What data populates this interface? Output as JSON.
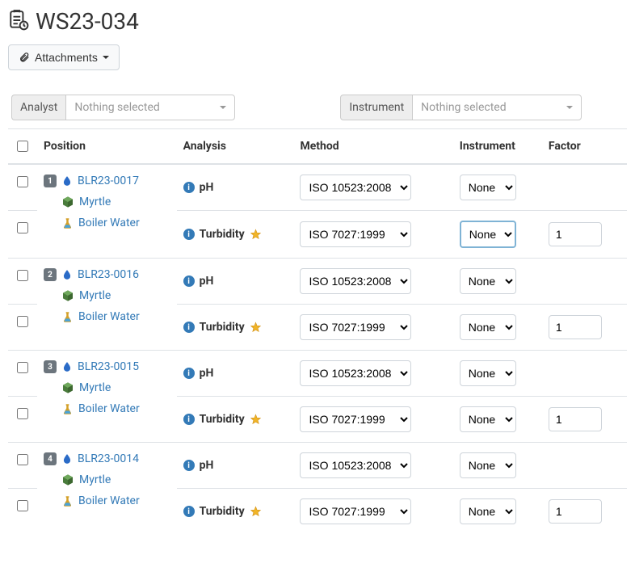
{
  "page": {
    "title": "WS23-034",
    "attachments_button": "Attachments"
  },
  "filters": {
    "analyst_label": "Analyst",
    "analyst_value": "Nothing selected",
    "instrument_label": "Instrument",
    "instrument_value": "Nothing selected"
  },
  "columns": {
    "position": "Position",
    "analysis": "Analysis",
    "method": "Method",
    "instrument": "Instrument",
    "factor": "Factor"
  },
  "instrument_options": {
    "none": "None"
  },
  "method_options": {
    "iso10523": "ISO 10523:2008",
    "iso7027": "ISO 7027:1999"
  },
  "rows": [
    {
      "position": "1",
      "sample_id": "BLR23-0017",
      "client": "Myrtle",
      "sample_type": "Boiler Water",
      "analyses": [
        {
          "name": "pH",
          "starred": false,
          "method": "ISO 10523:2008",
          "instrument": "None",
          "factor": ""
        },
        {
          "name": "Turbidity",
          "starred": true,
          "method": "ISO 7027:1999",
          "instrument": "None",
          "factor": "1",
          "instrument_focused": true
        }
      ]
    },
    {
      "position": "2",
      "sample_id": "BLR23-0016",
      "client": "Myrtle",
      "sample_type": "Boiler Water",
      "analyses": [
        {
          "name": "pH",
          "starred": false,
          "method": "ISO 10523:2008",
          "instrument": "None",
          "factor": ""
        },
        {
          "name": "Turbidity",
          "starred": true,
          "method": "ISO 7027:1999",
          "instrument": "None",
          "factor": "1"
        }
      ]
    },
    {
      "position": "3",
      "sample_id": "BLR23-0015",
      "client": "Myrtle",
      "sample_type": "Boiler Water",
      "analyses": [
        {
          "name": "pH",
          "starred": false,
          "method": "ISO 10523:2008",
          "instrument": "None",
          "factor": ""
        },
        {
          "name": "Turbidity",
          "starred": true,
          "method": "ISO 7027:1999",
          "instrument": "None",
          "factor": "1"
        }
      ]
    },
    {
      "position": "4",
      "sample_id": "BLR23-0014",
      "client": "Myrtle",
      "sample_type": "Boiler Water",
      "analyses": [
        {
          "name": "pH",
          "starred": false,
          "method": "ISO 10523:2008",
          "instrument": "None",
          "factor": ""
        },
        {
          "name": "Turbidity",
          "starred": true,
          "method": "ISO 7027:1999",
          "instrument": "None",
          "factor": "1"
        }
      ]
    }
  ]
}
